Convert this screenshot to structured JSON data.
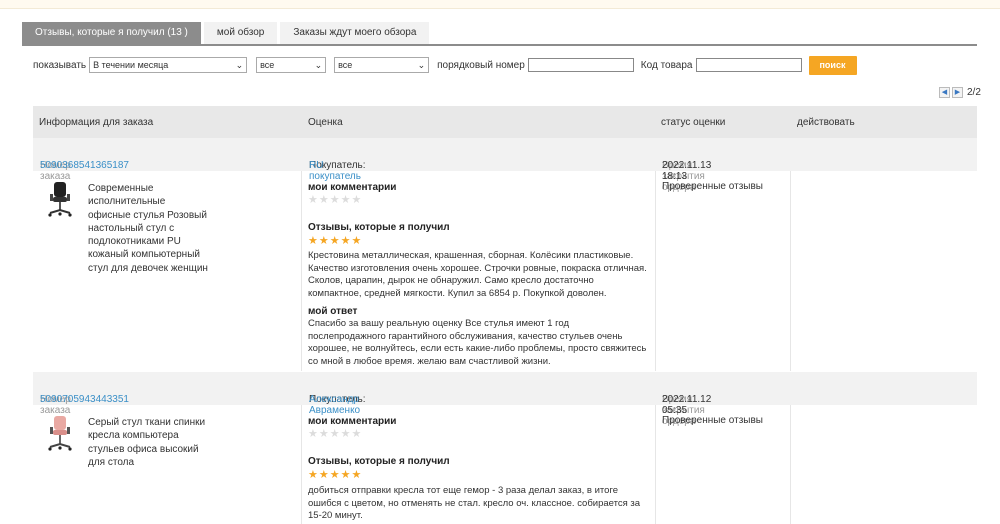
{
  "tabs": [
    {
      "label": "Отзывы, которые я получил (13 )"
    },
    {
      "label": "мой обзор"
    },
    {
      "label": "Заказы ждут моего обзора"
    }
  ],
  "filters": {
    "show_label": "показывать",
    "period_value": "В течении месяца",
    "filter2_value": "все",
    "filter3_value": "все",
    "order_number_label": "порядковый номер",
    "product_code_label": "Код товара",
    "search_button": "поиск"
  },
  "pager": {
    "text": "2/2",
    "prev_icon": "triangle-left",
    "next_icon": "triangle-right"
  },
  "table": {
    "headers": [
      "Информация для заказа",
      "Оценка",
      "статус оценки",
      "действовать"
    ]
  },
  "orders": [
    {
      "order_label": "Номер заказа",
      "order_number": "5090368541365187",
      "buyer_label": "Покупатель:",
      "buyer_name": "RU покупатель",
      "close_label": "Время закрытия ордера",
      "close_time": "2022.11.13 18:13",
      "product_name": "Современные исполнительные офисные стулья Розовый настольный стул с подлокотниками PU кожаный компьютерный стул для девочек женщин",
      "my_comments_label": "мои комментарии",
      "received_label": "Отзывы, которые я получил",
      "received_rating": 5,
      "received_text": "Крестовина металлическая, крашенная, сборная. Колёсики пластиковые. Качество изготовления очень хорошее. Строчки ровные, покраска отличная. Сколов, царапин, дырок не обнаружил. Само кресло достаточно компактное, средней мягкости. Купил за 6854 р. Покупкой доволен.",
      "reply_label": "мой ответ",
      "reply_text": "Спасибо за вашу реальную оценку Все стулья имеют 1 год послепродажного гарантийного обслуживания, качество стульев очень хорошее, не волнуйтесь, если есть какие-либо проблемы, просто свяжитесь со мной в любое время. желаю вам счастливой жизни.",
      "status": "Проверенные отзывы"
    },
    {
      "order_label": "Номер заказа",
      "order_number": "5090705943443351",
      "buyer_label": "Покупатель:",
      "buyer_name": "Александр Авраменко",
      "close_label": "Время закрытия ордера",
      "close_time": "2022.11.12 05:35",
      "product_name": "Серый стул ткани спинки кресла компьютера стульев офиса высокий для стола",
      "my_comments_label": "мои комментарии",
      "received_label": "Отзывы, которые я получил",
      "received_rating": 5,
      "received_text": "добиться отправки кресла тот еще гемор - 3 раза делал заказ, в итоге ошибся с цветом, но отменять не стал. кресло оч. классное. собирается за 15-20 минут.",
      "status": "Проверенные отзывы"
    }
  ],
  "colors": {
    "accent": "#f5a623",
    "link": "#3a8fc7",
    "tab_active": "#8c8c8c",
    "star_empty": "#dcdcdc"
  }
}
